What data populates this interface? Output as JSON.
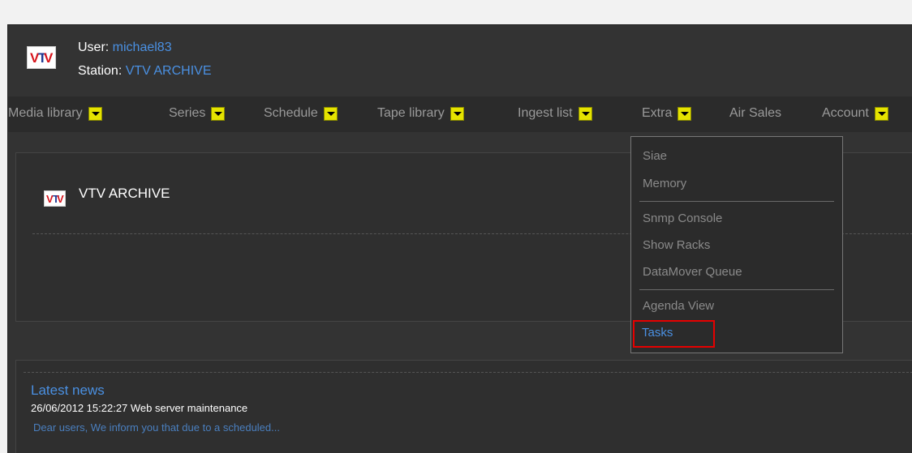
{
  "header": {
    "user_label": "User: ",
    "user_name": "michael83",
    "station_label": "Station: ",
    "station_name": "VTV ARCHIVE",
    "logo_letters": [
      "V",
      "T",
      "V"
    ]
  },
  "menubar": {
    "items": [
      {
        "label": "Media library",
        "has_dropdown": true
      },
      {
        "label": "Series",
        "has_dropdown": true
      },
      {
        "label": "Schedule",
        "has_dropdown": true
      },
      {
        "label": "Tape library",
        "has_dropdown": true
      },
      {
        "label": "Ingest list",
        "has_dropdown": true
      },
      {
        "label": "Extra",
        "has_dropdown": true
      },
      {
        "label": "Air Sales",
        "has_dropdown": false
      },
      {
        "label": "Account",
        "has_dropdown": true
      }
    ]
  },
  "station_panel": {
    "title": "VTV ARCHIVE"
  },
  "extra_menu": {
    "items": [
      {
        "label": "Siae"
      },
      {
        "label": "Memory"
      },
      {
        "label": "Snmp Console"
      },
      {
        "label": "Show Racks"
      },
      {
        "label": "DataMover Queue"
      },
      {
        "label": "Agenda View"
      },
      {
        "label": "Tasks",
        "highlighted": true
      }
    ]
  },
  "news": {
    "title": "Latest news",
    "item": "26/06/2012 15:22:27 Web server maintenance",
    "excerpt": "Dear users, We inform you that due to a scheduled..."
  },
  "colors": {
    "background": "#333333",
    "link": "#4a90e2",
    "menu_text": "#9a9a9a",
    "dropdown_button": "#e5e300",
    "highlight_box": "#e60000"
  }
}
